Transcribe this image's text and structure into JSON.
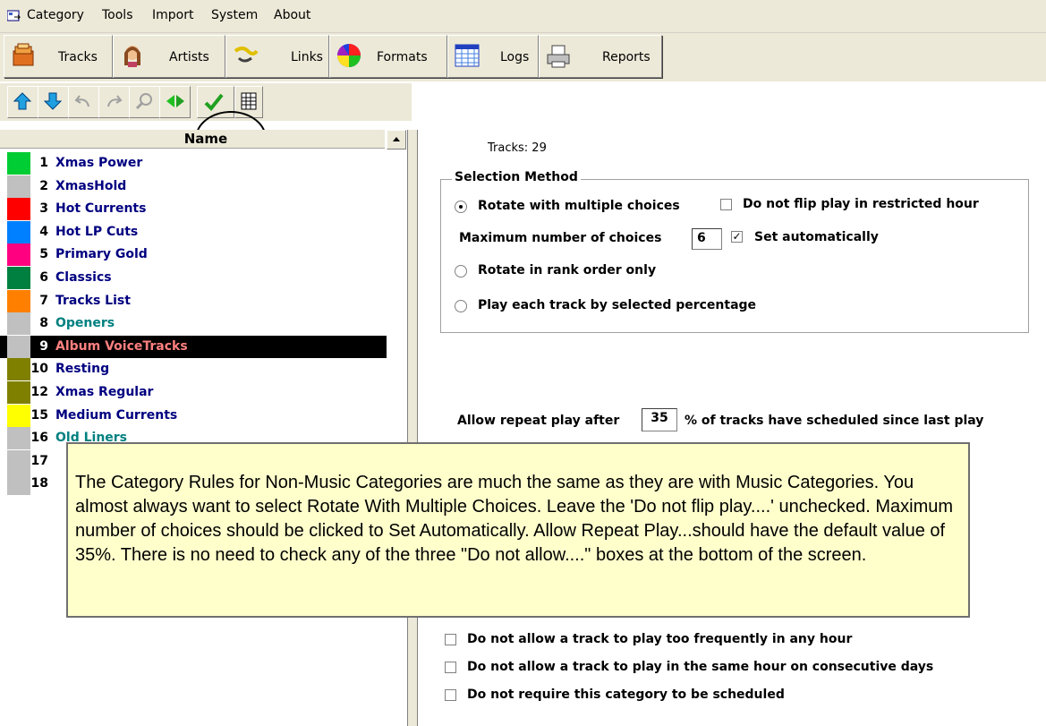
{
  "menu": [
    "Category",
    "Tools",
    "Import",
    "System",
    "About"
  ],
  "toolbar": [
    {
      "label": "Tracks",
      "icon": "tracks-icon"
    },
    {
      "label": "Artists",
      "icon": "artists-icon"
    },
    {
      "label": "Links",
      "icon": "links-icon"
    },
    {
      "label": "Formats",
      "icon": "formats-icon"
    },
    {
      "label": "Logs",
      "icon": "logs-icon"
    },
    {
      "label": "Reports",
      "icon": "reports-icon"
    }
  ],
  "list": {
    "header": "Name",
    "rows": [
      {
        "num": "1",
        "name": "Xmas Power",
        "color": "#00cc33"
      },
      {
        "num": "2",
        "name": "XmasHold",
        "color": "#c0c0c0"
      },
      {
        "num": "3",
        "name": "Hot Currents",
        "color": "#ff0000"
      },
      {
        "num": "4",
        "name": "Hot LP Cuts",
        "color": "#0080ff"
      },
      {
        "num": "5",
        "name": "Primary Gold",
        "color": "#ff0080"
      },
      {
        "num": "6",
        "name": "Classics",
        "color": "#008040"
      },
      {
        "num": "7",
        "name": "Tracks List",
        "color": "#ff8000"
      },
      {
        "num": "8",
        "name": "Openers",
        "color": "#c0c0c0"
      },
      {
        "num": "9",
        "name": "Album VoiceTracks",
        "color": "#c0c0c0"
      },
      {
        "num": "10",
        "name": "Resting",
        "color": "#808000"
      },
      {
        "num": "12",
        "name": "Xmas Regular",
        "color": "#808000"
      },
      {
        "num": "15",
        "name": "Medium Currents",
        "color": "#ffff00"
      },
      {
        "num": "16",
        "name": "Old Liners",
        "color": "#c0c0c0"
      },
      {
        "num": "17",
        "name": "",
        "color": "#c0c0c0"
      },
      {
        "num": "18",
        "name": "",
        "color": "#c0c0c0"
      }
    ]
  },
  "right": {
    "tracks_label": "Tracks: 29",
    "group_title": "Selection Method",
    "rotate_multiple": "Rotate with multiple choices",
    "no_flip": "Do not flip play in restricted hour",
    "max_choices_label": "Maximum number of choices",
    "max_choices_value": "6",
    "set_auto": "Set automatically",
    "rank_order": "Rotate in rank order only",
    "by_percentage": "Play each track by selected percentage",
    "repeat_pre": "Allow repeat play after",
    "repeat_value": "35",
    "repeat_post": "% of tracks have scheduled since last play",
    "chk_frequent": "Do not allow a track to play too frequently in any hour",
    "chk_same_hour": "Do not allow a track to play in the same hour on consecutive days",
    "chk_required": "Do not require this category to be scheduled"
  },
  "tooltip": "The Category Rules for Non-Music Categories are much the same as they are with Music Categories.  You almost always want to select Rotate With Multiple Choices. Leave the 'Do not flip play....'  unchecked.  Maximum number of choices should be clicked to Set Automatically.  Allow Repeat Play...should have the default value of 35%. There is no need to check any of the three \"Do not allow....\"  boxes at the bottom of the screen."
}
